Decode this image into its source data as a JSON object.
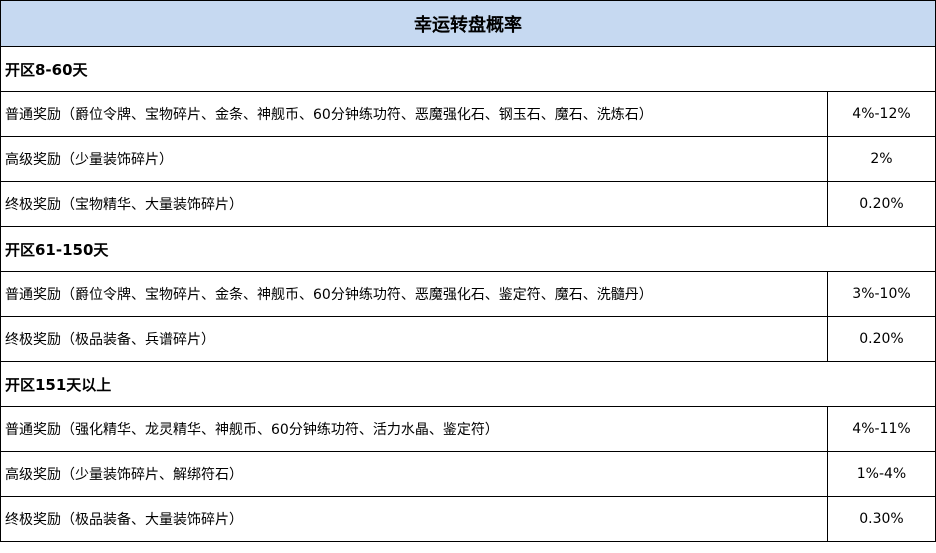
{
  "title": "幸运转盘概率",
  "sections": [
    {
      "heading": "开区8-60天",
      "rows": [
        {
          "label": "普通奖励（爵位令牌、宝物碎片、金条、神舰币、60分钟练功符、恶魔强化石、钢玉石、魔石、洗炼石）",
          "value": "4%-12%"
        },
        {
          "label": "高级奖励（少量装饰碎片）",
          "value": "2%"
        },
        {
          "label": "终极奖励（宝物精华、大量装饰碎片）",
          "value": "0.20%"
        }
      ]
    },
    {
      "heading": "开区61-150天",
      "rows": [
        {
          "label": "普通奖励（爵位令牌、宝物碎片、金条、神舰币、60分钟练功符、恶魔强化石、鉴定符、魔石、洗髓丹）",
          "value": "3%-10%"
        },
        {
          "label": "终极奖励（极品装备、兵谱碎片）",
          "value": "0.20%"
        }
      ]
    },
    {
      "heading": "开区151天以上",
      "rows": [
        {
          "label": "普通奖励（强化精华、龙灵精华、神舰币、60分钟练功符、活力水晶、鉴定符）",
          "value": "4%-11%"
        },
        {
          "label": "高级奖励（少量装饰碎片、解绑符石）",
          "value": "1%-4%"
        },
        {
          "label": "终极奖励（极品装备、大量装饰碎片）",
          "value": "0.30%"
        }
      ]
    }
  ]
}
